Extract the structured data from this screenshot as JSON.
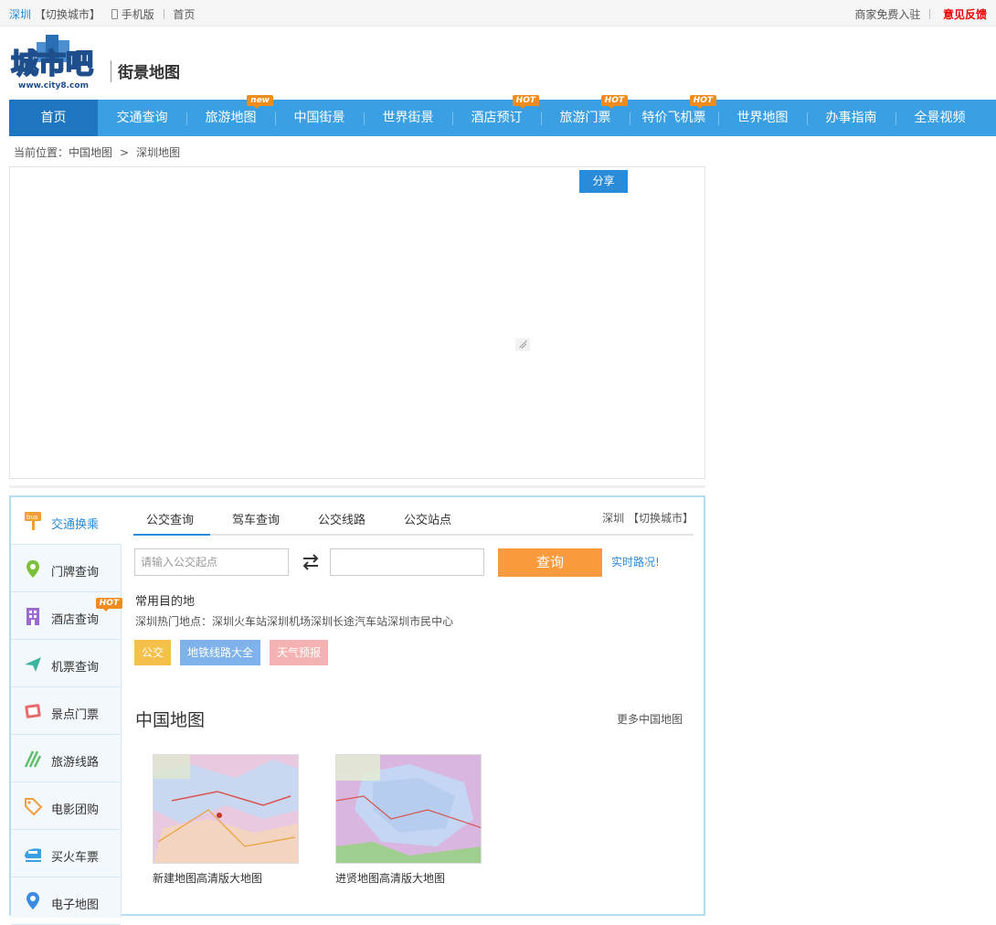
{
  "topbar": {
    "city": "深圳",
    "switch_city": "【切换城市】",
    "mobile": "手机版",
    "home": "首页",
    "merchant": "商家免费入驻",
    "feedback": "意见反馈"
  },
  "header": {
    "logo_text": "城市吧",
    "logo_url_text": "www.city8.com",
    "subtitle": "街景地图"
  },
  "nav": [
    {
      "label": "首页",
      "badge": ""
    },
    {
      "label": "交通查询",
      "badge": ""
    },
    {
      "label": "旅游地图",
      "badge": "new"
    },
    {
      "label": "中国街景",
      "badge": ""
    },
    {
      "label": "世界街景",
      "badge": ""
    },
    {
      "label": "酒店预订",
      "badge": "HOT"
    },
    {
      "label": "旅游门票",
      "badge": "HOT"
    },
    {
      "label": "特价飞机票",
      "badge": "HOT"
    },
    {
      "label": "世界地图",
      "badge": ""
    },
    {
      "label": "办事指南",
      "badge": ""
    },
    {
      "label": "全景视频",
      "badge": ""
    }
  ],
  "breadcrumb": {
    "prefix": "当前位置：",
    "item1": "中国地图",
    "sep": ">",
    "item2": "深圳地图"
  },
  "map": {
    "share": "分享"
  },
  "sidebar": [
    {
      "label": "交通换乘",
      "icon": "bus-sign-icon",
      "badge": ""
    },
    {
      "label": "门牌查询",
      "icon": "location-pin-icon",
      "badge": ""
    },
    {
      "label": "酒店查询",
      "icon": "hotel-building-icon",
      "badge": "HOT"
    },
    {
      "label": "机票查询",
      "icon": "airplane-icon",
      "badge": ""
    },
    {
      "label": "景点门票",
      "icon": "photo-ticket-icon",
      "badge": ""
    },
    {
      "label": "旅游线路",
      "icon": "route-lines-icon",
      "badge": ""
    },
    {
      "label": "电影团购",
      "icon": "tag-icon",
      "badge": ""
    },
    {
      "label": "买火车票",
      "icon": "train-icon",
      "badge": ""
    },
    {
      "label": "电子地图",
      "icon": "map-pin-icon",
      "badge": ""
    }
  ],
  "tabs": [
    {
      "label": "公交查询"
    },
    {
      "label": "驾车查询"
    },
    {
      "label": "公交线路"
    },
    {
      "label": "公交站点"
    }
  ],
  "city_switch": "深圳 【切换城市】",
  "search": {
    "start_placeholder": "请输入公交起点",
    "end_value": "",
    "button": "查询",
    "realtime": "实时路况!"
  },
  "common": {
    "title": "常用目的地",
    "prefix": "深圳热门地点：",
    "places": [
      "深圳火车站",
      "深圳机场",
      "深圳长途汽车站",
      "深圳市民中心"
    ]
  },
  "tags": [
    {
      "label": "公交",
      "color": "#f5c04a"
    },
    {
      "label": "地铁线路大全",
      "color": "#7fb2ea"
    },
    {
      "label": "天气预报",
      "color": "#f5b2b2"
    }
  ],
  "china_maps": {
    "title": "中国地图",
    "more": "更多中国地图",
    "items": [
      {
        "caption": "新建地图高清版大地图"
      },
      {
        "caption": "进贤地图高清版大地图"
      }
    ]
  },
  "colors": {
    "nav_bg": "#3ba0e3",
    "nav_active": "#1e75c0",
    "accent": "#2a8bd8",
    "query_button": "#f99b3c",
    "hot_badge": "#f08c1c",
    "feedback": "#e00000"
  }
}
